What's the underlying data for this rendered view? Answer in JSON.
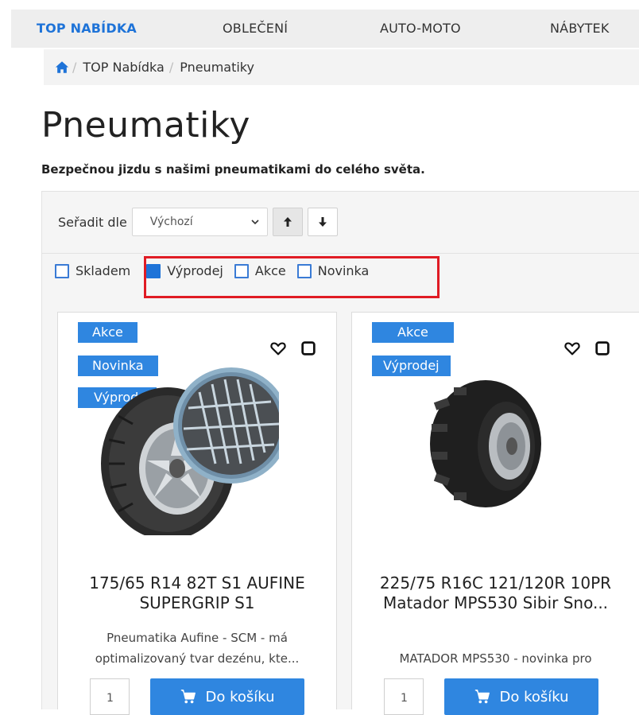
{
  "nav": {
    "items": [
      {
        "label": "TOP NABÍDKA",
        "active": true
      },
      {
        "label": "OBLEČENÍ",
        "active": false
      },
      {
        "label": "AUTO-MOTO",
        "active": false
      },
      {
        "label": "NÁBYTEK",
        "active": false
      }
    ]
  },
  "breadcrumb": {
    "items": [
      "TOP Nabídka",
      "Pneumatiky"
    ],
    "separator": "/"
  },
  "page": {
    "title": "Pneumatiky",
    "subtitle": "Bezpečnou jizdu s našimi pneumatikami do celého světa."
  },
  "sort": {
    "label": "Seřadit dle",
    "selected": "Výchozí"
  },
  "filters": [
    {
      "label": "Skladem",
      "checked": false
    },
    {
      "label": "Výprodej",
      "checked": true
    },
    {
      "label": "Akce",
      "checked": false
    },
    {
      "label": "Novinka",
      "checked": false
    }
  ],
  "products": [
    {
      "badges": [
        "Akce",
        "Novinka",
        "Výprodej"
      ],
      "title": "175/65 R14 82T S1 AUFINE SUPERGRIP S1",
      "description": "Pneumatika Aufine - SCM - má optimalizovaný tvar dezénu, kte...",
      "qty": "1",
      "cart_label": "Do košíku"
    },
    {
      "badges": [
        "Akce",
        "Výprodej"
      ],
      "title": "225/75 R16C 121/120R 10PR Matador MPS530 Sibir Sno...",
      "description": "MATADOR MPS530 - novinka pro",
      "qty": "1",
      "cart_label": "Do košíku"
    }
  ],
  "colors": {
    "accent": "#1e73d8",
    "badge": "#2f86e0",
    "highlight": "#e01b24"
  }
}
